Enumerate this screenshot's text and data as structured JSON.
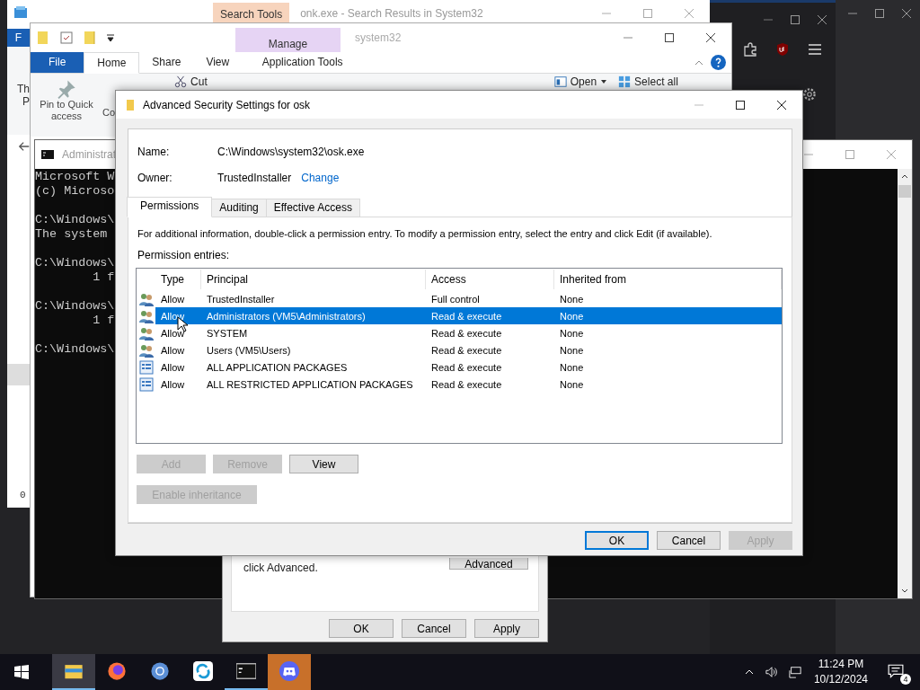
{
  "search_window": {
    "context_tab": "Search Tools",
    "title": "onk.exe - Search Results in System32",
    "file_tab": "F",
    "ribbon_text": "Th",
    "ribbon_text_2": "P",
    "status": "0"
  },
  "explorer_window": {
    "context_tab": "Manage",
    "title": "system32",
    "tabs": [
      {
        "label": "File",
        "kind": "file",
        "selected": false
      },
      {
        "label": "Home",
        "kind": "tab",
        "selected": true
      },
      {
        "label": "Share",
        "kind": "tab",
        "selected": false
      },
      {
        "label": "View",
        "kind": "tab",
        "selected": false
      },
      {
        "label": "Application Tools",
        "kind": "context",
        "selected": false
      }
    ],
    "pin_button": "Pin to Quick access",
    "copy_button": "Co",
    "cut_button": "Cut",
    "open_button": "Open",
    "select_all_button": "Select all"
  },
  "console_window": {
    "title": "Administrat",
    "blocks": [
      [
        "Microsoft W",
        "(c) Microso"
      ],
      [
        "C:\\Windows\\",
        "The system"
      ],
      [
        "C:\\Windows\\",
        "        1 f"
      ],
      [
        "C:\\Windows\\",
        "        1 f"
      ],
      [
        "C:\\Windows\\"
      ]
    ]
  },
  "properties_dialog": {
    "hint": "click Advanced.",
    "advanced_button": "Advanced",
    "buttons": [
      "OK",
      "Cancel",
      "Apply"
    ]
  },
  "security_dialog": {
    "title": "Advanced Security Settings for osk",
    "name_label": "Name:",
    "name": "C:\\Windows\\system32\\osk.exe",
    "owner_label": "Owner:",
    "owner": "TrustedInstaller",
    "change_link": "Change",
    "tabs": [
      {
        "label": "Permissions",
        "selected": true
      },
      {
        "label": "Auditing",
        "selected": false
      },
      {
        "label": "Effective Access",
        "selected": false
      }
    ],
    "info": "For additional information, double-click a permission entry. To modify a permission entry, select the entry and click Edit (if available).",
    "entries_label": "Permission entries:",
    "columns": [
      "Type",
      "Principal",
      "Access",
      "Inherited from"
    ],
    "rows": [
      {
        "kind": "group",
        "type": "Allow",
        "principal": "TrustedInstaller",
        "access": "Full control",
        "inherited": "None",
        "selected": false
      },
      {
        "kind": "group",
        "type": "Allow",
        "principal": "Administrators (VM5\\Administrators)",
        "access": "Read & execute",
        "inherited": "None",
        "selected": true
      },
      {
        "kind": "group",
        "type": "Allow",
        "principal": "SYSTEM",
        "access": "Read & execute",
        "inherited": "None",
        "selected": false
      },
      {
        "kind": "group",
        "type": "Allow",
        "principal": "Users (VM5\\Users)",
        "access": "Read & execute",
        "inherited": "None",
        "selected": false
      },
      {
        "kind": "package",
        "type": "Allow",
        "principal": "ALL APPLICATION PACKAGES",
        "access": "Read & execute",
        "inherited": "None",
        "selected": false
      },
      {
        "kind": "package",
        "type": "Allow",
        "principal": "ALL RESTRICTED APPLICATION PACKAGES",
        "access": "Read & execute",
        "inherited": "None",
        "selected": false
      }
    ],
    "entry_buttons": [
      {
        "label": "Add",
        "disabled": true
      },
      {
        "label": "Remove",
        "disabled": true
      },
      {
        "label": "View",
        "disabled": false
      }
    ],
    "inheritance_button": {
      "label": "Enable inheritance",
      "disabled": true
    },
    "footer_buttons": [
      {
        "label": "OK",
        "disabled": false,
        "default": true
      },
      {
        "label": "Cancel",
        "disabled": false,
        "default": false
      },
      {
        "label": "Apply",
        "disabled": true,
        "default": false
      }
    ]
  },
  "taskbar": {
    "apps": [
      {
        "kind": "explorer",
        "selected": true,
        "running": true,
        "attention": false
      },
      {
        "kind": "firefox",
        "selected": false,
        "running": false,
        "attention": false
      },
      {
        "kind": "browser",
        "selected": false,
        "running": false,
        "attention": false
      },
      {
        "kind": "sync",
        "selected": false,
        "running": false,
        "attention": false
      },
      {
        "kind": "console",
        "selected": false,
        "running": true,
        "attention": false
      },
      {
        "kind": "chat",
        "selected": false,
        "running": false,
        "attention": true
      }
    ],
    "time": "11:24 PM",
    "date": "10/12/2024",
    "notifications": "4"
  }
}
